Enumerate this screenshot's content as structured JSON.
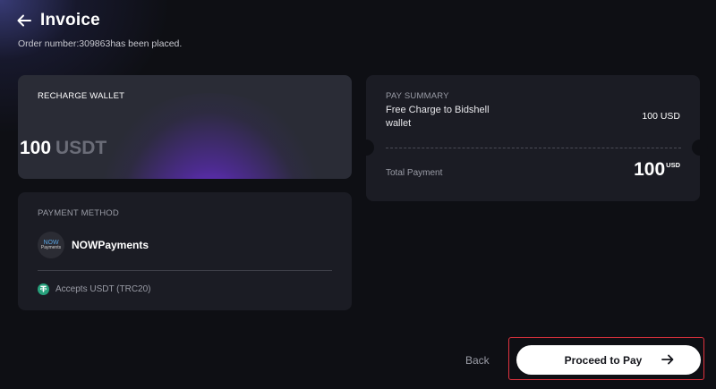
{
  "header": {
    "title": "Invoice",
    "order_line": "Order number:309863has been placed.",
    "back_icon": "arrow-left-icon"
  },
  "recharge": {
    "label": "RECHARGE WALLET",
    "amount": "100",
    "currency": "USDT",
    "accent_color": "#7a2ff0"
  },
  "payment_method": {
    "label": "PAYMENT METHOD",
    "logo_line1": "NOW",
    "logo_line2": "Payments",
    "provider": "NOWPayments",
    "accepts": "Accepts USDT (TRC20)",
    "tether_color": "#27a17c"
  },
  "summary": {
    "label": "PAY SUMMARY",
    "item_desc": "Free Charge to Bidshell wallet",
    "item_price": "100 USD",
    "total_label": "Total Payment",
    "total_amount": "100",
    "total_currency": "USD"
  },
  "actions": {
    "back_label": "Back",
    "proceed_label": "Proceed to Pay",
    "proceed_icon": "arrow-right-icon",
    "highlight_color": "#e0323e"
  }
}
